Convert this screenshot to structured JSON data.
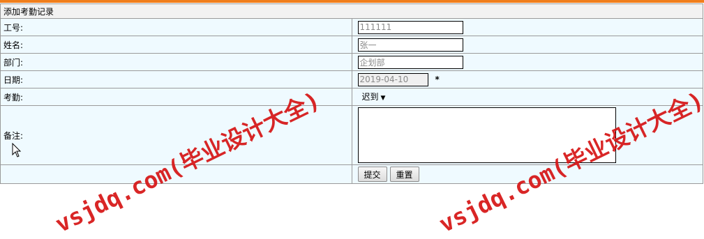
{
  "form": {
    "title": "添加考勤记录",
    "fields": {
      "emp_id": {
        "label": "工号:",
        "value": "111111"
      },
      "name": {
        "label": "姓名:",
        "value": "张一"
      },
      "dept": {
        "label": "部门:",
        "value": "企划部"
      },
      "date": {
        "label": "日期:",
        "value": "2019-04-10",
        "required_mark": "*"
      },
      "attendance": {
        "label": "考勤:",
        "selected": "迟到"
      },
      "memo": {
        "label": "备注:",
        "value": ""
      }
    },
    "buttons": {
      "submit": "提交",
      "reset": "重置"
    }
  },
  "watermark": {
    "text": "vsjdq.com(毕业设计大全)",
    "color": "#d61414"
  },
  "colors": {
    "accent_bar": "#f07e1c",
    "row_bg": "#effaff",
    "title_bg": "#f2f2f2"
  }
}
